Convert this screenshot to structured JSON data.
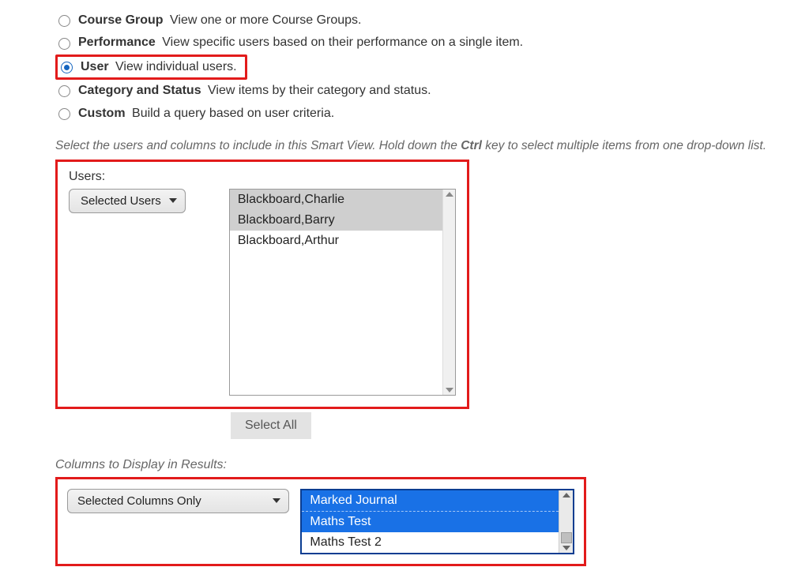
{
  "radios": {
    "course_group": {
      "label": "Course Group",
      "desc": "View one or more Course Groups."
    },
    "performance": {
      "label": "Performance",
      "desc": "View specific users based on their performance on a single item."
    },
    "user": {
      "label": "User",
      "desc": "View individual users."
    },
    "category": {
      "label": "Category and Status",
      "desc": "View items by their category and status."
    },
    "custom": {
      "label": "Custom",
      "desc": "Build a query based on user criteria."
    }
  },
  "instruction": {
    "pre": "Select the users and columns to include in this Smart View. Hold down the ",
    "key": "Ctrl",
    "post": " key to select multiple items from one drop-down list."
  },
  "users": {
    "field_label": "Users:",
    "dropdown_value": "Selected Users",
    "options": {
      "charlie": "Blackboard,Charlie",
      "barry": "Blackboard,Barry",
      "arthur": "Blackboard,Arthur"
    },
    "select_all": "Select All"
  },
  "columns": {
    "section_label": "Columns to Display in Results:",
    "dropdown_value": "Selected Columns Only",
    "options": {
      "marked_journal": "Marked Journal",
      "maths_test": "Maths Test",
      "maths_test_2": "Maths Test 2"
    }
  }
}
